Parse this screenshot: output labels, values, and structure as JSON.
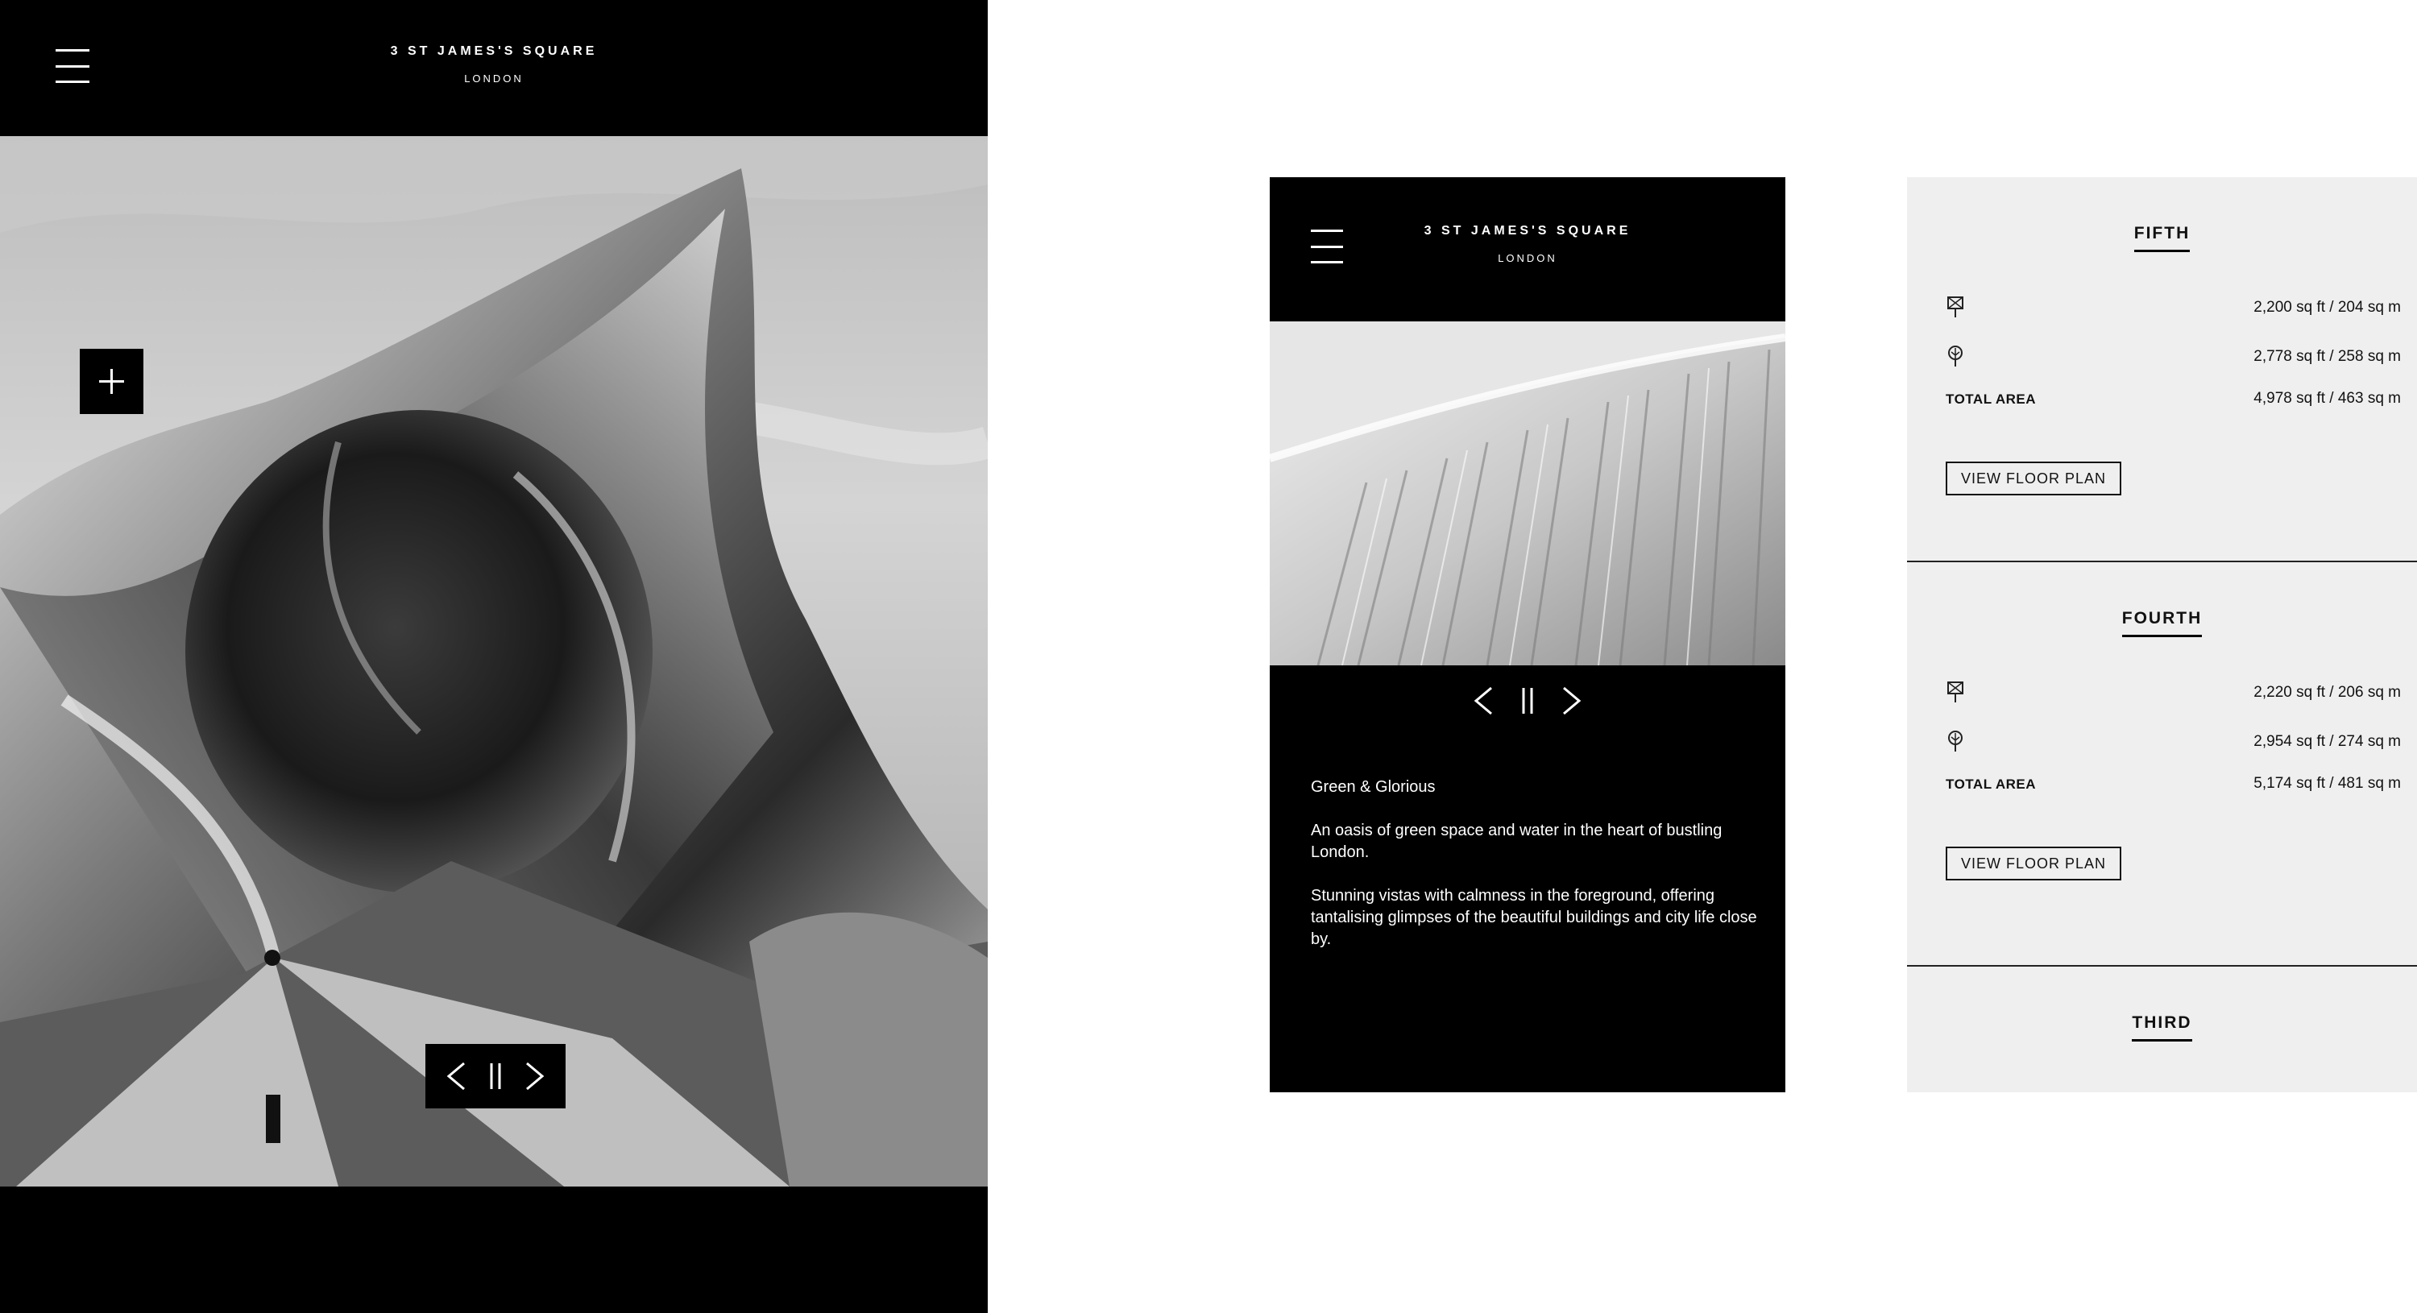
{
  "brand": {
    "title": "3 ST JAMES'S SQUARE",
    "subtitle": "LONDON"
  },
  "left_panel": {
    "controls": {
      "prev": "chevron-left",
      "pause": "pause",
      "next": "chevron-right"
    },
    "plus_icon": "plus-icon"
  },
  "phone": {
    "slide": {
      "heading": "Green & Glorious",
      "paragraphs": [
        "An oasis of green space and water in the heart of bustling London.",
        "Stunning vistas with calmness in the foreground, offering tantalising glimpses of the beautiful buildings and city life close by."
      ]
    }
  },
  "floors": [
    {
      "name": "FIFTH",
      "rows": [
        {
          "icon": "floor-area-icon",
          "value": "2,200 sq ft / 204 sq m"
        },
        {
          "icon": "terrace-area-icon",
          "value": "2,778 sq ft / 258 sq m"
        }
      ],
      "total_label": "TOTAL AREA",
      "total_value": "4,978 sq ft / 463 sq m",
      "button": "VIEW FLOOR PLAN"
    },
    {
      "name": "FOURTH",
      "rows": [
        {
          "icon": "floor-area-icon",
          "value": "2,220 sq ft / 206 sq m"
        },
        {
          "icon": "terrace-area-icon",
          "value": "2,954 sq ft / 274 sq m"
        }
      ],
      "total_label": "TOTAL AREA",
      "total_value": "5,174 sq ft / 481 sq m",
      "button": "VIEW FLOOR PLAN"
    },
    {
      "name": "THIRD"
    }
  ],
  "colors": {
    "black": "#000000",
    "panel_grey": "#efefef",
    "white": "#ffffff"
  }
}
